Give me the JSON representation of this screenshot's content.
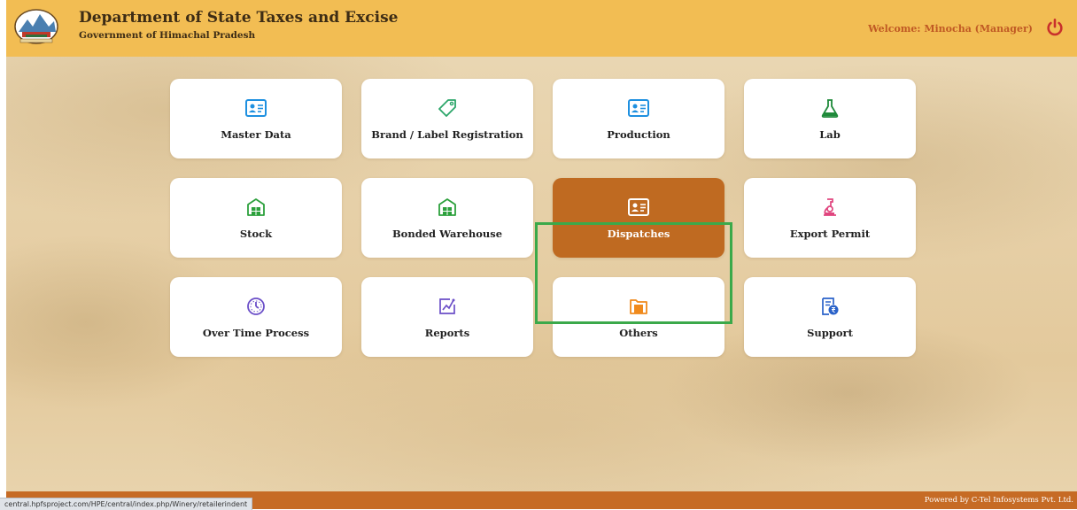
{
  "header": {
    "title": "Department of State Taxes and Excise",
    "subtitle": "Government of Himachal Pradesh",
    "welcome": "Welcome: Minocha (Manager)",
    "power_icon": "power-icon",
    "logo": "himachal-pradesh-emblem"
  },
  "tiles": [
    {
      "label": "Master Data",
      "icon": "id-card-icon",
      "color": "#1e90e0"
    },
    {
      "label": "Brand / Label Registration",
      "icon": "tag-icon",
      "color": "#2ca66a"
    },
    {
      "label": "Production",
      "icon": "id-card-icon",
      "color": "#1e90e0"
    },
    {
      "label": "Lab",
      "icon": "flask-icon",
      "color": "#1f8a3a"
    },
    {
      "label": "Stock",
      "icon": "warehouse-icon",
      "color": "#2ca03c"
    },
    {
      "label": "Bonded Warehouse",
      "icon": "warehouse-icon",
      "color": "#2ca03c"
    },
    {
      "label": "Dispatches",
      "icon": "id-card-icon",
      "color": "#ffffff",
      "active": true
    },
    {
      "label": "Export Permit",
      "icon": "microscope-icon",
      "color": "#e0457e"
    },
    {
      "label": "Over Time Process",
      "icon": "clock-icon",
      "color": "#6b4fc8"
    },
    {
      "label": "Reports",
      "icon": "chart-icon",
      "color": "#6b4fc8"
    },
    {
      "label": "Others",
      "icon": "folder-icon",
      "color": "#f08a1c"
    },
    {
      "label": "Support",
      "icon": "rupee-document-icon",
      "color": "#2a62c9"
    }
  ],
  "footer": {
    "powered_by": "Powered by C-Tel Infosystems Pvt. Ltd.",
    "status_url": "central.hpfsproject.com/HPE/central/index.php/Winery/retailerindent"
  },
  "colors": {
    "header_bg": "#f2bd53",
    "footer_bg": "#c66b25",
    "active_tile": "#bf6a21",
    "highlight_border": "#3ba94a"
  }
}
